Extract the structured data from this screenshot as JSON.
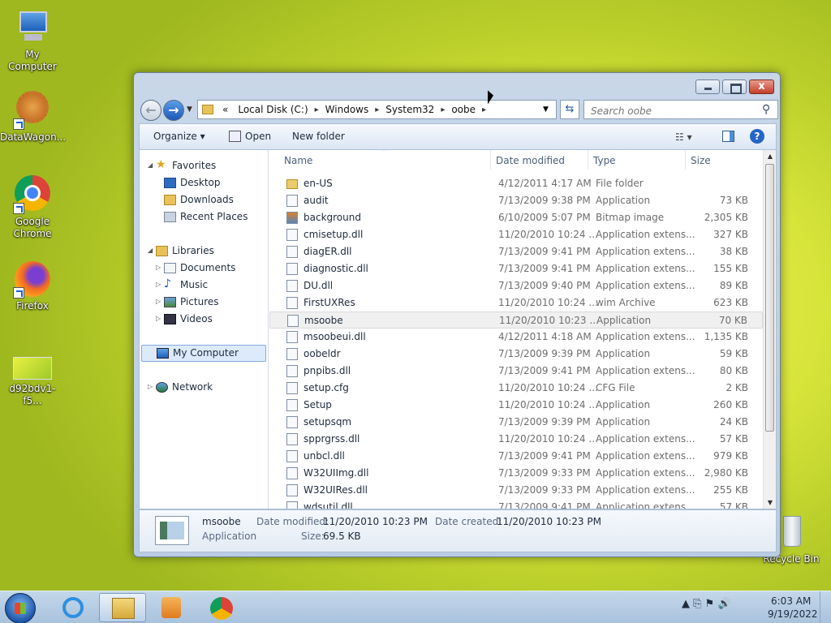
{
  "desktop": {
    "icons": [
      {
        "label": "My Computer",
        "icon": "computer-icon"
      },
      {
        "label": "DataWagon...",
        "icon": "datawagon-icon"
      },
      {
        "label": "Google Chrome",
        "icon": "chrome-icon"
      },
      {
        "label": "Firefox",
        "icon": "firefox-icon"
      },
      {
        "label": "d92bdv1-f5...",
        "icon": "image-file-icon"
      },
      {
        "label": "Recycle Bin",
        "icon": "recycle-bin-icon"
      }
    ]
  },
  "window": {
    "controls": {
      "close": "x"
    },
    "address": {
      "recent_chevron": "«",
      "crumbs": [
        "Local Disk (C:)",
        "Windows",
        "System32",
        "oobe"
      ],
      "separator": "▸"
    },
    "search_placeholder": "Search oobe",
    "toolbar": {
      "organize": "Organize ▾",
      "open": "Open",
      "new_folder": "New folder",
      "views": "☷ ▾",
      "help": "?"
    },
    "nav": {
      "favorites": "Favorites",
      "desktop": "Desktop",
      "downloads": "Downloads",
      "recent": "Recent Places",
      "libraries": "Libraries",
      "documents": "Documents",
      "music": "Music",
      "pictures": "Pictures",
      "videos": "Videos",
      "computer": "My Computer",
      "network": "Network"
    },
    "columns": {
      "name": "Name",
      "date": "Date modified",
      "type": "Type",
      "size": "Size"
    },
    "files": [
      {
        "name": "en-US",
        "date": "4/12/2011 4:17 AM",
        "type": "File folder",
        "size": "",
        "kind": "folder"
      },
      {
        "name": "audit",
        "date": "7/13/2009 9:38 PM",
        "type": "Application",
        "size": "73 KB",
        "kind": "app"
      },
      {
        "name": "background",
        "date": "6/10/2009 5:07 PM",
        "type": "Bitmap image",
        "size": "2,305 KB",
        "kind": "img"
      },
      {
        "name": "cmisetup.dll",
        "date": "11/20/2010 10:24 ...",
        "type": "Application extens...",
        "size": "327 KB",
        "kind": "dll"
      },
      {
        "name": "diagER.dll",
        "date": "7/13/2009 9:41 PM",
        "type": "Application extens...",
        "size": "38 KB",
        "kind": "dll"
      },
      {
        "name": "diagnostic.dll",
        "date": "7/13/2009 9:41 PM",
        "type": "Application extens...",
        "size": "155 KB",
        "kind": "dll"
      },
      {
        "name": "DU.dll",
        "date": "7/13/2009 9:40 PM",
        "type": "Application extens...",
        "size": "89 KB",
        "kind": "dll"
      },
      {
        "name": "FirstUXRes",
        "date": "11/20/2010 10:24 ...",
        "type": "wim Archive",
        "size": "623 KB",
        "kind": "wim"
      },
      {
        "name": "msoobe",
        "date": "11/20/2010 10:23 ...",
        "type": "Application",
        "size": "70 KB",
        "kind": "app",
        "selected": true
      },
      {
        "name": "msoobeui.dll",
        "date": "4/12/2011 4:18 AM",
        "type": "Application extens...",
        "size": "1,135 KB",
        "kind": "dll"
      },
      {
        "name": "oobeldr",
        "date": "7/13/2009 9:39 PM",
        "type": "Application",
        "size": "59 KB",
        "kind": "app"
      },
      {
        "name": "pnpibs.dll",
        "date": "7/13/2009 9:41 PM",
        "type": "Application extens...",
        "size": "80 KB",
        "kind": "dll"
      },
      {
        "name": "setup.cfg",
        "date": "11/20/2010 10:24 ...",
        "type": "CFG File",
        "size": "2 KB",
        "kind": "cfg"
      },
      {
        "name": "Setup",
        "date": "11/20/2010 10:24 ...",
        "type": "Application",
        "size": "260 KB",
        "kind": "app"
      },
      {
        "name": "setupsqm",
        "date": "7/13/2009 9:39 PM",
        "type": "Application",
        "size": "24 KB",
        "kind": "app"
      },
      {
        "name": "spprgrss.dll",
        "date": "11/20/2010 10:24 ...",
        "type": "Application extens...",
        "size": "57 KB",
        "kind": "dll"
      },
      {
        "name": "unbcl.dll",
        "date": "7/13/2009 9:41 PM",
        "type": "Application extens...",
        "size": "979 KB",
        "kind": "dll"
      },
      {
        "name": "W32UIImg.dll",
        "date": "7/13/2009 9:33 PM",
        "type": "Application extens...",
        "size": "2,980 KB",
        "kind": "dll"
      },
      {
        "name": "W32UIRes.dll",
        "date": "7/13/2009 9:33 PM",
        "type": "Application extens...",
        "size": "255 KB",
        "kind": "dll"
      },
      {
        "name": "wdsutil.dll",
        "date": "7/13/2009 9:41 PM",
        "type": "Application extens...",
        "size": "57 KB",
        "kind": "dll"
      }
    ],
    "details": {
      "name": "msoobe",
      "type": "Application",
      "modified_label": "Date modified:",
      "modified": "11/20/2010 10:23 PM",
      "created_label": "Date created:",
      "created": "11/20/2010 10:23 PM",
      "size_label": "Size:",
      "size": "69.5 KB"
    }
  },
  "taskbar": {
    "tray_icons": "▲  ⎘  ⚑  🔊",
    "time": "6:03 AM",
    "date": "9/19/2022"
  }
}
